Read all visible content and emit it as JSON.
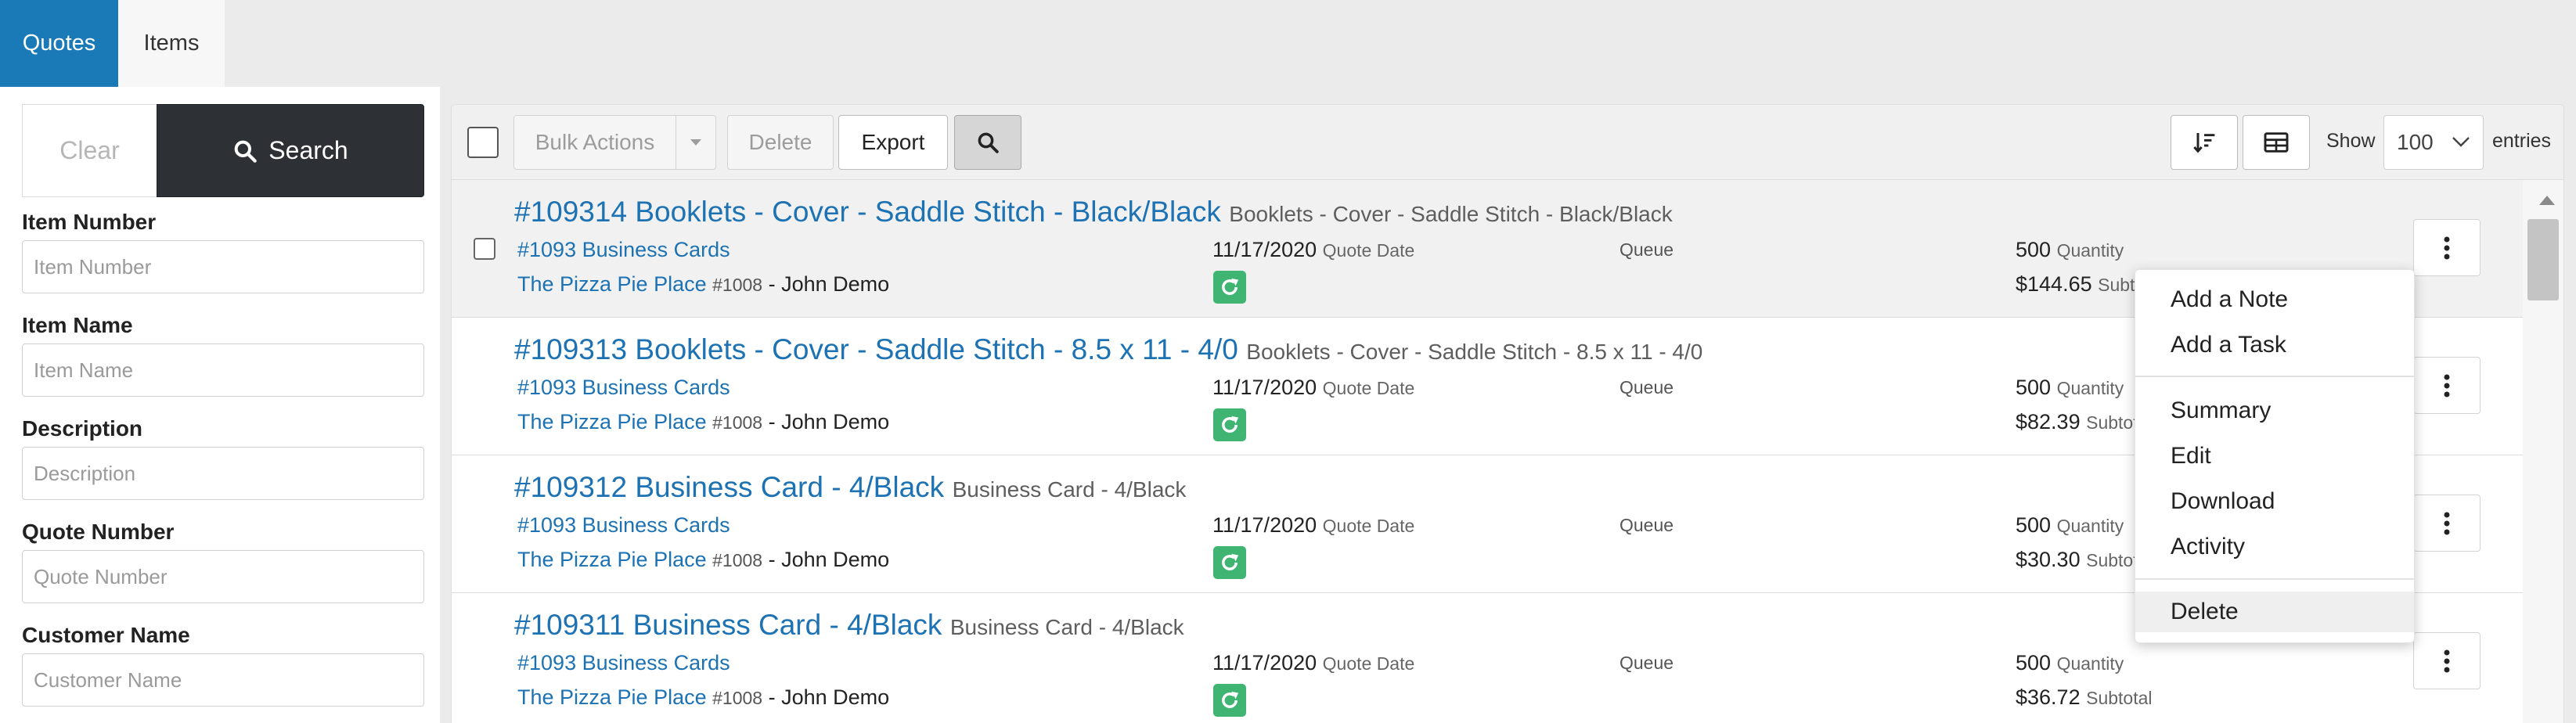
{
  "tabs": [
    {
      "label": "Quotes",
      "active": true
    },
    {
      "label": "Items",
      "active": false
    }
  ],
  "filters": {
    "clear_label": "Clear",
    "search_label": "Search",
    "fields": [
      {
        "label": "Item Number",
        "placeholder": "Item Number"
      },
      {
        "label": "Item Name",
        "placeholder": "Item Name"
      },
      {
        "label": "Description",
        "placeholder": "Description"
      },
      {
        "label": "Quote Number",
        "placeholder": "Quote Number"
      },
      {
        "label": "Customer Name",
        "placeholder": "Customer Name"
      }
    ]
  },
  "toolbar": {
    "bulk_actions_label": "Bulk Actions",
    "delete_label": "Delete",
    "export_label": "Export",
    "show_label": "Show",
    "entries_value": "100",
    "entries_label": "entries"
  },
  "rows": [
    {
      "title": "#109314 Booklets - Cover - Saddle Stitch - Black/Black",
      "subtitle": "Booklets - Cover - Saddle Stitch - Black/Black",
      "product": "#1093 Business Cards",
      "customer": "The Pizza Pie Place",
      "customer_id": "#1008",
      "contact": "- John Demo",
      "date": "11/17/2020",
      "date_label": "Quote Date",
      "queue": "Queue",
      "quantity": "500",
      "quantity_label": "Quantity",
      "subtotal": "$144.65",
      "subtotal_label": "Subtotal"
    },
    {
      "title": "#109313 Booklets - Cover - Saddle Stitch - 8.5 x 11 - 4/0",
      "subtitle": "Booklets - Cover - Saddle Stitch - 8.5 x 11 - 4/0",
      "product": "#1093 Business Cards",
      "customer": "The Pizza Pie Place",
      "customer_id": "#1008",
      "contact": "- John Demo",
      "date": "11/17/2020",
      "date_label": "Quote Date",
      "queue": "Queue",
      "quantity": "500",
      "quantity_label": "Quantity",
      "subtotal": "$82.39",
      "subtotal_label": "Subtotal"
    },
    {
      "title": "#109312 Business Card - 4/Black",
      "subtitle": "Business Card - 4/Black",
      "product": "#1093 Business Cards",
      "customer": "The Pizza Pie Place",
      "customer_id": "#1008",
      "contact": "- John Demo",
      "date": "11/17/2020",
      "date_label": "Quote Date",
      "queue": "Queue",
      "quantity": "500",
      "quantity_label": "Quantity",
      "subtotal": "$30.30",
      "subtotal_label": "Subtotal"
    },
    {
      "title": "#109311 Business Card - 4/Black",
      "subtitle": "Business Card - 4/Black",
      "product": "#1093 Business Cards",
      "customer": "The Pizza Pie Place",
      "customer_id": "#1008",
      "contact": "- John Demo",
      "date": "11/17/2020",
      "date_label": "Quote Date",
      "queue": "Queue",
      "quantity": "500",
      "quantity_label": "Quantity",
      "subtotal": "$36.72",
      "subtotal_label": "Subtotal"
    }
  ],
  "menu": {
    "items": [
      "Add a Note",
      "Add a Task",
      "Summary",
      "Edit",
      "Download",
      "Activity",
      "Delete"
    ]
  },
  "colors": {
    "accent": "#1a7ab7",
    "link": "#1d72b3",
    "search_button": "#2d3034",
    "refresh_green": "#40b573"
  },
  "icons": {
    "search": "search-icon",
    "sort": "sort-icon",
    "columns": "table-columns-icon",
    "refresh": "refresh-icon",
    "kebab": "vertical-ellipsis-icon",
    "caret": "caret-down-icon"
  }
}
